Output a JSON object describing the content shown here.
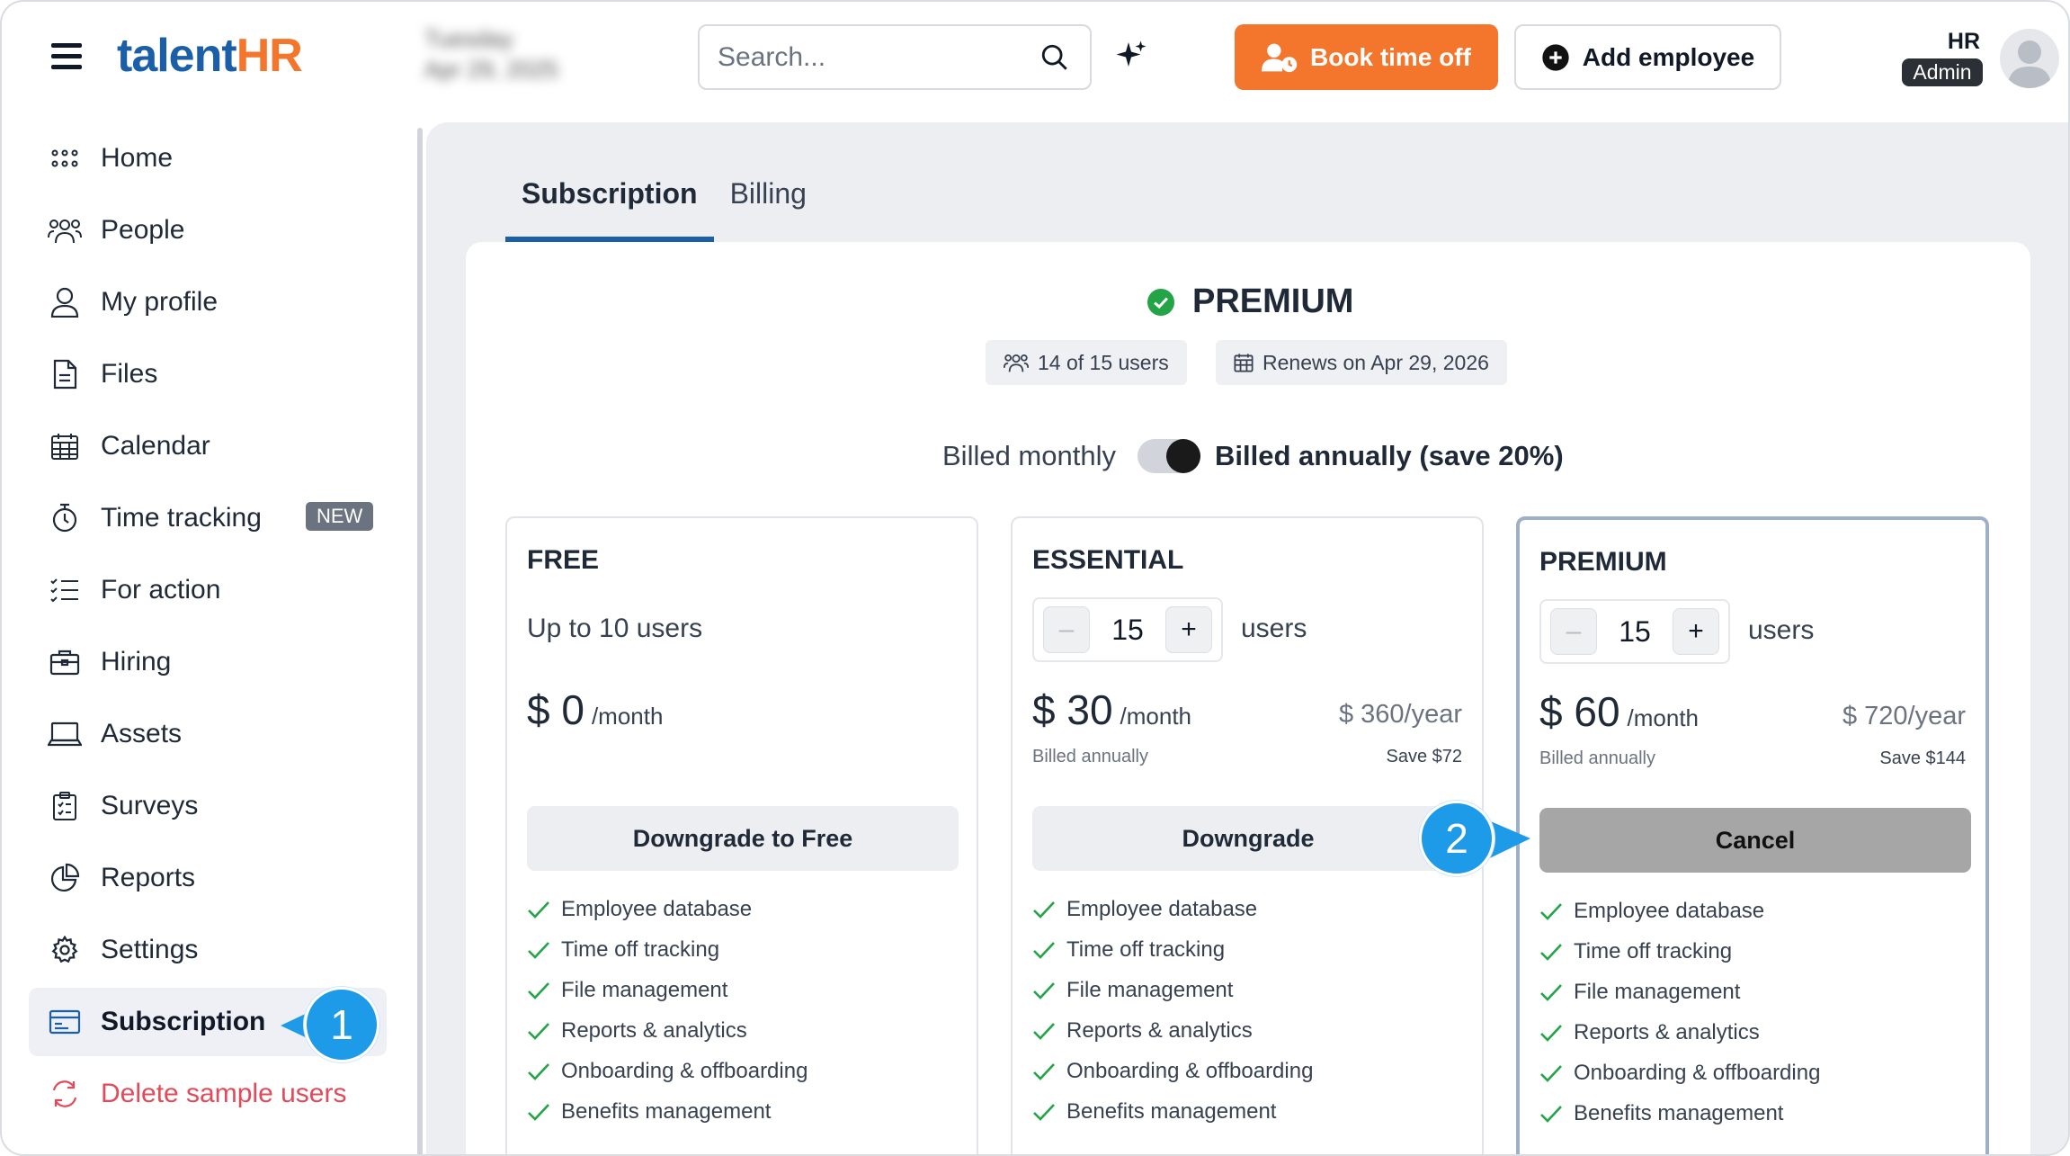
{
  "header": {
    "logo_talent": "talent",
    "logo_hr": "HR",
    "date_line1": "Tuesday",
    "date_line2": "Apr 29, 2025",
    "search_placeholder": "Search...",
    "book_label": "Book time off",
    "add_label": "Add employee",
    "role_name": "HR",
    "role_badge": "Admin"
  },
  "sidebar": {
    "items": [
      {
        "label": "Home",
        "icon": "grid-icon"
      },
      {
        "label": "People",
        "icon": "people-icon"
      },
      {
        "label": "My profile",
        "icon": "user-icon"
      },
      {
        "label": "Files",
        "icon": "file-icon"
      },
      {
        "label": "Calendar",
        "icon": "calendar-icon"
      },
      {
        "label": "Time tracking",
        "icon": "stopwatch-icon",
        "badge": "NEW"
      },
      {
        "label": "For action",
        "icon": "checklist-icon"
      },
      {
        "label": "Hiring",
        "icon": "briefcase-icon"
      },
      {
        "label": "Assets",
        "icon": "laptop-icon"
      },
      {
        "label": "Surveys",
        "icon": "clipboard-icon"
      },
      {
        "label": "Reports",
        "icon": "pie-chart-icon"
      },
      {
        "label": "Settings",
        "icon": "gear-icon"
      },
      {
        "label": "Subscription",
        "icon": "card-icon",
        "active": true
      },
      {
        "label": "Delete sample users",
        "icon": "refresh-icon"
      }
    ]
  },
  "tabs": {
    "subscription": "Subscription",
    "billing": "Billing"
  },
  "current_plan": {
    "name": "PREMIUM",
    "users_chip": "14 of 15 users",
    "renews_chip": "Renews on Apr 29, 2026"
  },
  "billing_toggle": {
    "monthly": "Billed monthly",
    "annually": "Billed annually (save 20%)",
    "annual_selected": true
  },
  "plans": [
    {
      "name": "FREE",
      "users_text": "Up to 10 users",
      "price": "$ 0",
      "per": "/month",
      "action": "Downgrade to Free"
    },
    {
      "name": "ESSENTIAL",
      "count": "15",
      "users_label": "users",
      "price": "$ 30",
      "per": "/month",
      "year": "$ 360/year",
      "billed": "Billed annually",
      "save": "Save $72",
      "action": "Downgrade"
    },
    {
      "name": "PREMIUM",
      "count": "15",
      "users_label": "users",
      "price": "$ 60",
      "per": "/month",
      "year": "$ 720/year",
      "billed": "Billed annually",
      "save": "Save $144",
      "action": "Cancel"
    }
  ],
  "features": [
    "Employee database",
    "Time off tracking",
    "File management",
    "Reports & analytics",
    "Onboarding & offboarding",
    "Benefits management"
  ],
  "callouts": {
    "one": "1",
    "two": "2"
  },
  "colors": {
    "brand_blue": "#1a5fa8",
    "brand_orange": "#f4762c",
    "check_green": "#22a447",
    "callout_blue": "#1e9be8",
    "danger": "#e24a5a"
  }
}
